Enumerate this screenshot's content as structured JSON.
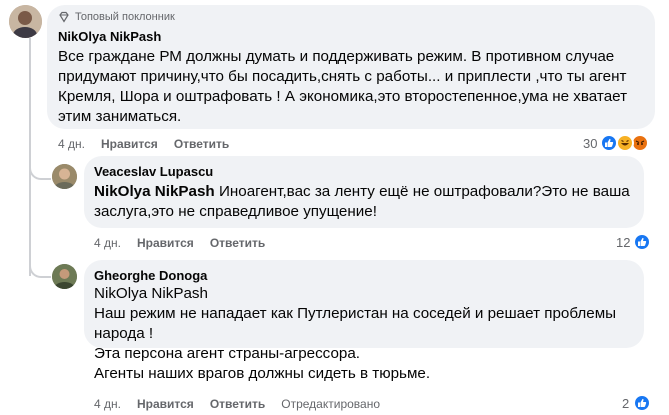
{
  "comments": [
    {
      "badge_text": "Топовый поклонник",
      "author": "NikOlya NikPash",
      "lines": [
        "Все граждане РМ должны думать и поддерживать режим. В противном случае",
        "придумают причину,что бы посадить,снять с работы... и приплести ,что ты агент",
        "Кремля, Шора и оштрафовать ! А экономика,это второстепенное,ума не хватает",
        "этим заниматься."
      ],
      "time": "4 дн.",
      "like_label": "Нравится",
      "reply_label": "Ответить",
      "reaction_count": "30"
    },
    {
      "author": "Veaceslav Lupascu",
      "mention": "NikOlya NikPash",
      "line1_rest": " Иноагент,вас за ленту ещё не оштрафовали?Это не ваша",
      "line2": "заслуга,это не справедливое упущение!",
      "time": "4 дн.",
      "like_label": "Нравится",
      "reply_label": "Ответить",
      "reaction_count": "12"
    },
    {
      "author": "Gheorghe Donoga",
      "lines": [
        "NikOlya NikPash",
        "Наш режим не нападает как Путлеристан на соседей и решает проблемы",
        "народа !",
        "Эта персона агент страны-агрессора.",
        "Агенты наших врагов должны сидеть в тюрьме."
      ],
      "time": "4 дн.",
      "like_label": "Нравится",
      "reply_label": "Ответить",
      "edited_label": "Отредактировано",
      "reaction_count": "2"
    }
  ],
  "colors": {
    "bubble": "#f0f2f5",
    "like_blue": "#1877f2",
    "secondary_text": "#65676b",
    "thread_line": "#ced0d4"
  }
}
